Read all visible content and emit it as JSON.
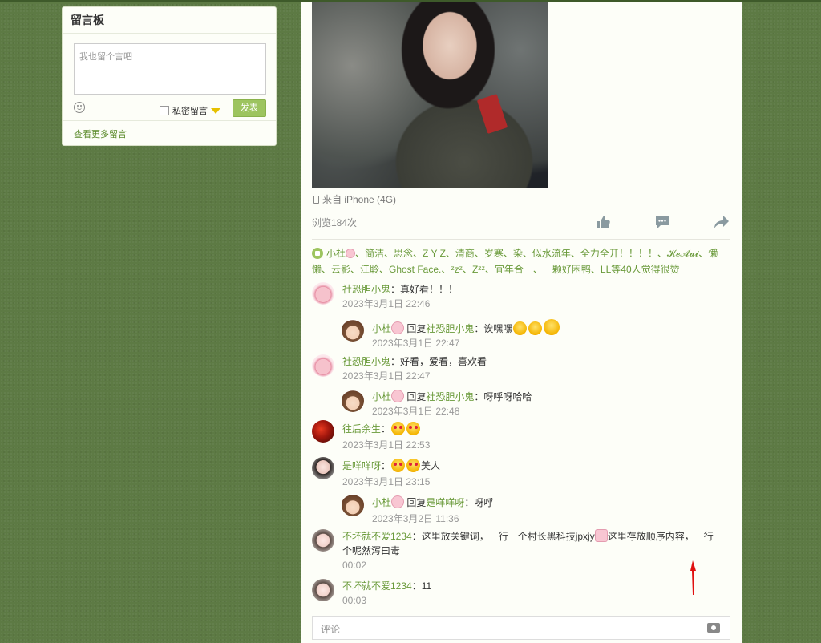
{
  "guestbook": {
    "title": "留言板",
    "textarea_placeholder": "我也留个言吧",
    "private_label": "私密留言",
    "submit_label": "发表",
    "more_link": "查看更多留言"
  },
  "post": {
    "source": "来自 iPhone (4G)",
    "views": "浏览184次",
    "likes_names": "小杜",
    "likes_rest": "、简洁、思念、Z Y Z、清商、岁寒、染、似水流年、全力全开！！！！、𝓚𝓮𝓐𝓪𝓲、懒懒、云影、江聆、Ghost Face.、",
    "likes_zz": "ᶻzᶻ、Zᶻᶻ、宜年合一、一颗好困鸭",
    "likes_tail": "、LL等40人觉得很赞",
    "comment_placeholder": "评论"
  },
  "comments": [
    {
      "name": "社恐胆小鬼",
      "text": "：真好看！！！",
      "time": "2023年3月1日 22:46"
    },
    {
      "name": "小杜",
      "reply_word": "回复",
      "reply_to": "社恐胆小鬼",
      "text": "：诶嘿嘿",
      "time": "2023年3月1日 22:47"
    },
    {
      "name": "社恐胆小鬼",
      "text": "：好看，爱看，喜欢看",
      "time": "2023年3月1日 22:47"
    },
    {
      "name": "小杜",
      "reply_word": "回复",
      "reply_to": "社恐胆小鬼",
      "text": "：呀呼呀哈哈",
      "time": "2023年3月1日 22:48"
    },
    {
      "name": "往后余生",
      "text": "：",
      "time": "2023年3月1日 22:53"
    },
    {
      "name": "是咩咩呀",
      "text": "：",
      "text2": "美人",
      "time": "2023年3月1日 23:15"
    },
    {
      "name": "小杜",
      "reply_word": "回复",
      "reply_to": "是咩咩呀",
      "text": "：呀呼",
      "time": "2023年3月2日 11:36"
    },
    {
      "name": "不坏就不爱1234",
      "text": "：这里放关键词，一行一个村长黑科技jpxjy",
      "text2": "这里存放顺序内容，一行一个呢然泻曰毒",
      "time": "00:02"
    },
    {
      "name": "不坏就不爱1234",
      "text": "：11",
      "time": "00:03"
    }
  ]
}
